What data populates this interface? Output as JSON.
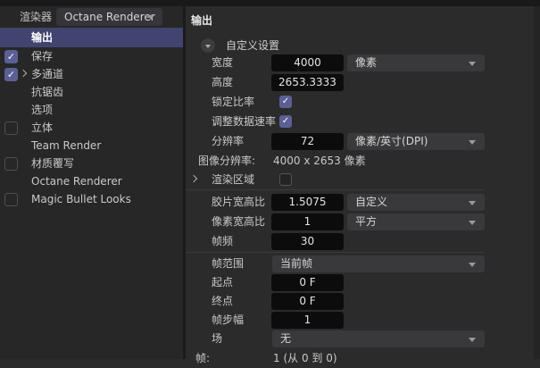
{
  "colors": {
    "selection": "#41446E",
    "checkbox_accent": "#5C5F95",
    "input_bg": "#0C0C0C",
    "dropdown_bg": "#39393C",
    "panel_bg": "#2B2B2B",
    "sidebar_bg": "#272727"
  },
  "toolbar": {
    "renderer_label": "渲染器",
    "renderer_value": "Octane Renderer"
  },
  "sidebar": {
    "items": [
      {
        "label": "输出",
        "selected": true
      },
      {
        "label": "保存",
        "checkbox": "checked"
      },
      {
        "label": "多通道",
        "checkbox": "checked",
        "expandable": true
      },
      {
        "label": "抗锯齿"
      },
      {
        "label": "选项"
      },
      {
        "label": "立体",
        "checkbox": "unchecked"
      },
      {
        "label": "Team Render"
      },
      {
        "label": "材质覆写",
        "checkbox": "unchecked"
      },
      {
        "label": "Octane Renderer"
      },
      {
        "label": "Magic Bullet Looks",
        "checkbox": "unchecked"
      }
    ]
  },
  "main": {
    "title": "输出",
    "preset_label": "自定义设置",
    "fields": {
      "width": {
        "label": "宽度",
        "value": "4000",
        "unit": "像素"
      },
      "height": {
        "label": "高度",
        "value": "2653.3333"
      },
      "lock_ratio": {
        "label": "锁定比率",
        "checked": true
      },
      "adjust_data_rate": {
        "label": "调整数据速率",
        "checked": true
      },
      "resolution": {
        "label": "分辨率",
        "value": "72",
        "unit": "像素/英寸(DPI)"
      },
      "image_resolution": {
        "label": "图像分辨率:",
        "value": "4000 x 2653 像素"
      },
      "render_region": {
        "label": "渲染区域",
        "checked": false
      },
      "film_aspect": {
        "label": "胶片宽高比",
        "value": "1.5075",
        "unit": "自定义"
      },
      "pixel_aspect": {
        "label": "像素宽高比",
        "value": "1",
        "unit": "平方"
      },
      "frame_rate": {
        "label": "帧频",
        "value": "30"
      },
      "frame_range": {
        "label": "帧范围",
        "value": "当前帧"
      },
      "start": {
        "label": "起点",
        "value": "0 F"
      },
      "end": {
        "label": "终点",
        "value": "0 F"
      },
      "frame_step": {
        "label": "帧步幅",
        "value": "1"
      },
      "field": {
        "label": "场",
        "value": "无"
      },
      "frames": {
        "label": "帧:",
        "value": "1 (从 0 到 0)"
      }
    }
  }
}
